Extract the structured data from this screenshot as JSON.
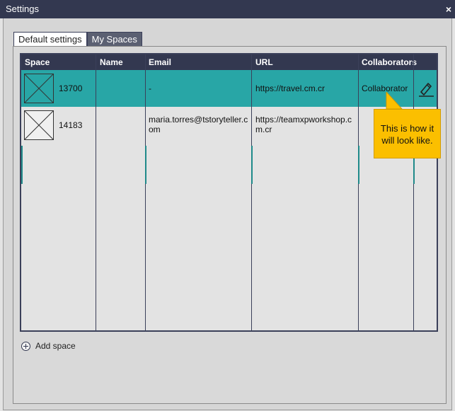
{
  "window": {
    "title": "Settings",
    "close_glyph": "×"
  },
  "tabs": [
    {
      "label": "Default settings",
      "active": false
    },
    {
      "label": "My Spaces",
      "active": true
    }
  ],
  "table": {
    "columns": [
      "Space",
      "Name",
      "Email",
      "URL",
      "Collaborators"
    ],
    "rows": [
      {
        "space_id": "13700",
        "name": "",
        "email": "-",
        "url": "https://travel.cm.cr",
        "collaborators": "Collaborator",
        "selected": true
      },
      {
        "space_id": "14183",
        "name": "",
        "email": "maria.torres@tstoryteller.com",
        "url": "https://teamxpworkshop.cm.cr",
        "collaborators": "",
        "selected": false
      }
    ]
  },
  "tooltip": {
    "text": "This is how it will look like."
  },
  "add_space": {
    "label": "Add space",
    "icon": "plus-circle-icon"
  },
  "colors": {
    "header": "#333850",
    "selected_row": "#28a6a6",
    "tooltip": "#fbbf00"
  }
}
